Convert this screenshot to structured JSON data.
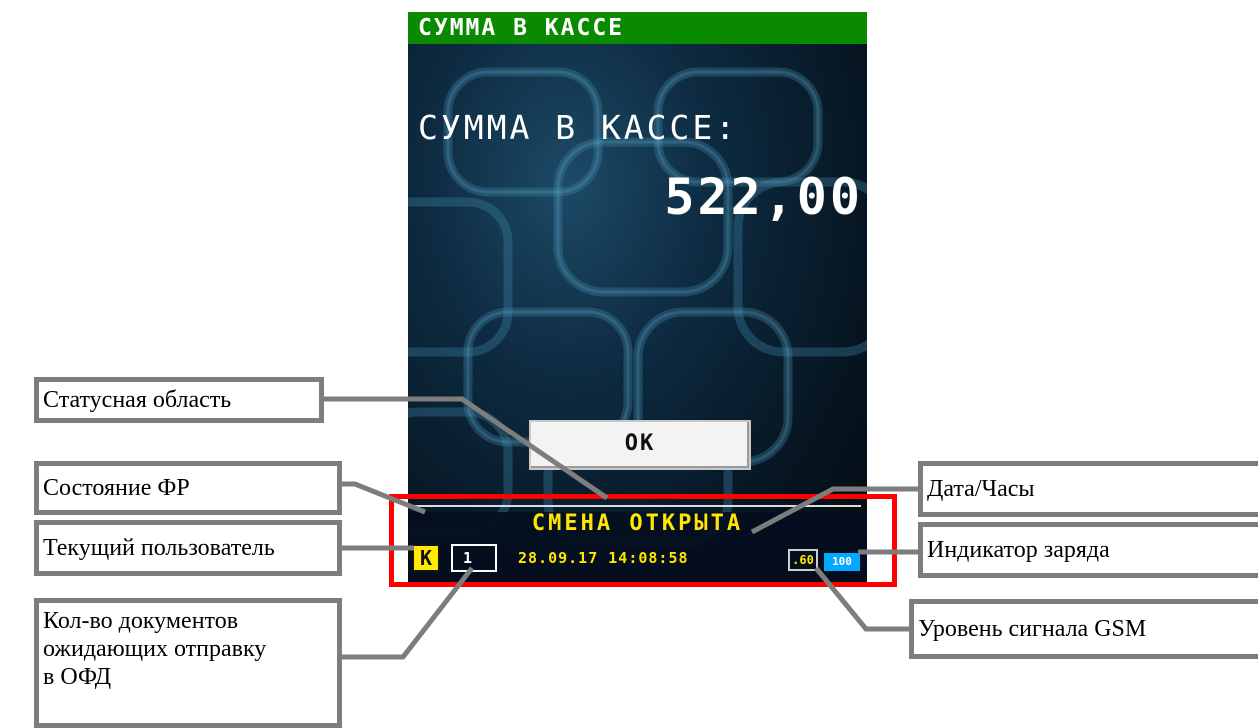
{
  "screen": {
    "title": "СУММА В КАССЕ",
    "sum_label": "СУММА В КАССЕ:",
    "sum_value": "522,00",
    "ok_label": "OK",
    "status": {
      "fr_state": "СМЕНА ОТКРЫТА",
      "user": "К",
      "pending_docs": "1",
      "datetime": "28.09.17 14:08:58",
      "gsm_level": ".60",
      "battery": "100"
    }
  },
  "callouts": {
    "status_area": "Статусная область",
    "fr_state": "Состояние ФР",
    "current_user": "Текущий пользователь",
    "pending_docs": [
      "Кол-во документов",
      "ожидающих отправку",
      "в ОФД"
    ],
    "datetime": "Дата/Часы",
    "battery": "Индикатор заряда",
    "gsm": "Уровень сигнала GSM"
  },
  "colors": {
    "title_bar": "#0a8a00",
    "highlight": "#ff0000",
    "callout_border": "#7d7d7d",
    "status_text": "#ffe600",
    "battery": "#00a8ff"
  }
}
